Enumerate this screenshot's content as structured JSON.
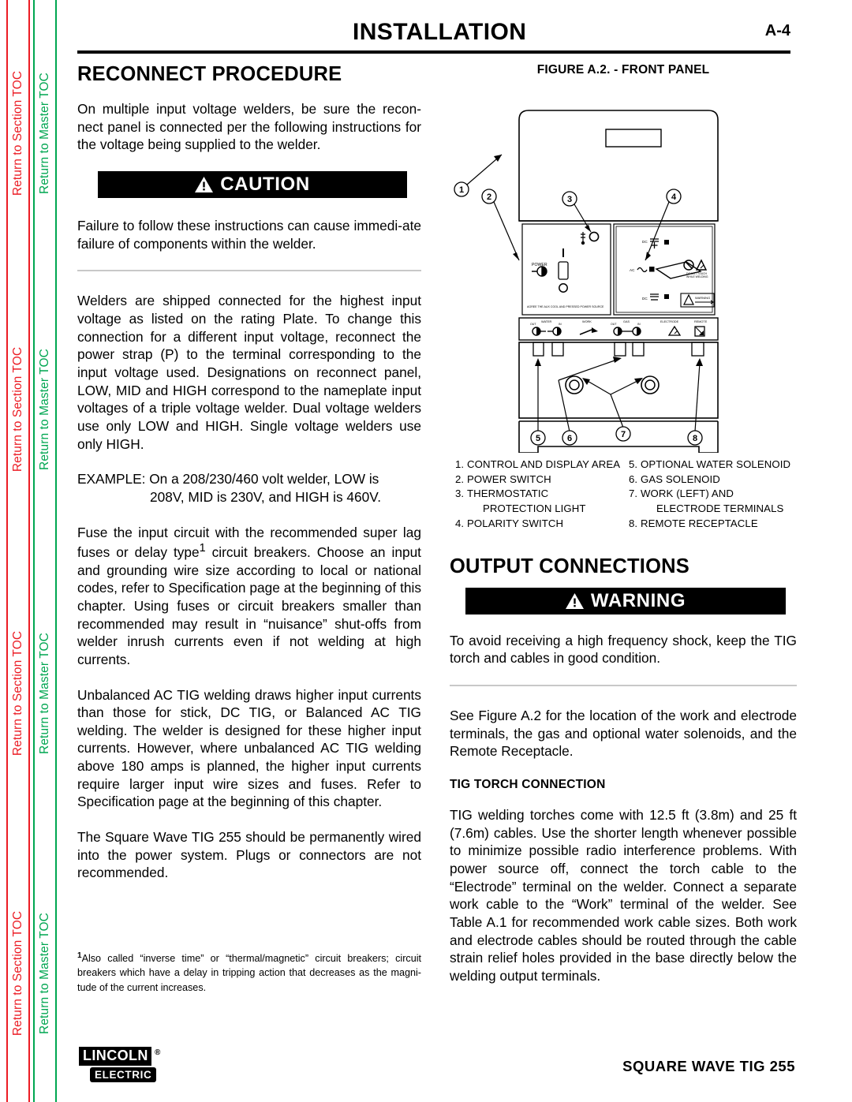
{
  "sidebar": {
    "section_toc_label": "Return to Section TOC",
    "master_toc_label": "Return to Master TOC",
    "section_color": "#ec1c24",
    "master_color": "#00a651",
    "repeat_count": 4
  },
  "header": {
    "title": "INSTALLATION",
    "page_number": "A-4"
  },
  "left_column": {
    "section_title": "RECONNECT PROCEDURE",
    "intro_paragraph": "On multiple input voltage welders, be sure the recon-nect panel is connected per the following instructions for the voltage being supplied to the welder.",
    "caution_banner": "CAUTION",
    "caution_text": "Failure to follow these instructions can cause immedi-ate failure of components within the welder.",
    "paragraph_2": "Welders are shipped connected for the highest input voltage as listed on the rating Plate. To change this connection for a different input voltage, reconnect the power strap (P) to the terminal corresponding to the input voltage used. Designations on reconnect panel, LOW, MID and HIGH correspond to the nameplate input voltages of a triple voltage welder. Dual voltage welders use only LOW and HIGH. Single voltage welders use only HIGH.",
    "example_label": "EXAMPLE: On a 208/230/460 volt welder, LOW is",
    "example_cont": "208V, MID is 230V, and HIGH is 460V.",
    "paragraph_3_a": "Fuse the input circuit with the recommended super lag fuses or delay type",
    "paragraph_3_sup": "1",
    "paragraph_3_b": " circuit breakers. Choose an input and grounding wire size according to local or national codes, refer to Specification page at the beginning of this chapter. Using fuses or circuit breakers smaller than recommended may result in “nuisance” shut-offs from welder inrush currents even if not welding at high currents.",
    "paragraph_4": "Unbalanced AC TIG welding draws higher input currents than those for stick, DC TIG, or Balanced AC TIG welding. The welder is designed for these higher input currents. However, where unbalanced AC TIG welding above 180 amps is planned, the higher input currents require larger input wire sizes and fuses. Refer to Specification page at the beginning of this chapter.",
    "paragraph_5": "The Square Wave TIG 255 should be permanently wired into the power system. Plugs or connectors are not recommended.",
    "footnote_marker": "1",
    "footnote_text": "Also called “inverse time” or “thermal/magnetic” circuit breakers; circuit breakers which have a delay in tripping action that decreases as the magni-tude of the current increases."
  },
  "figure": {
    "caption": "FIGURE A.2. - FRONT PANEL",
    "callouts": [
      "1",
      "2",
      "3",
      "4",
      "5",
      "6",
      "7",
      "8"
    ],
    "panel_labels": {
      "power": "POWER",
      "power_note": "AGREE THE  AUX COOL AND  PRESSED POWER SOURCE",
      "dc_plus": "DC",
      "ac": "AC",
      "dc_minus": "DC",
      "do_not_touch": "DO NOT TOUCH WHILE WELDING",
      "warning_small": "WARNING"
    },
    "terminal_labels": {
      "water": "WATER",
      "water_out": "OUT",
      "water_in": "IN",
      "work": "WORK",
      "gas": "GAS",
      "gas_out": "OUT",
      "gas_in": "IN",
      "electrode": "ELECTRODE",
      "remote": "REMOTE"
    },
    "legend_left": [
      {
        "num": "1.",
        "text": "CONTROL AND DISPLAY AREA"
      },
      {
        "num": "2.",
        "text": "POWER SWITCH"
      },
      {
        "num": "3.",
        "text": "THERMOSTATIC",
        "cont": "PROTECTION LIGHT"
      },
      {
        "num": "4.",
        "text": "POLARITY SWITCH"
      }
    ],
    "legend_right": [
      {
        "num": "5.",
        "text": "OPTIONAL WATER SOLENOID"
      },
      {
        "num": "6.",
        "text": "GAS SOLENOID"
      },
      {
        "num": "7.",
        "text": "WORK (LEFT) AND",
        "cont": "ELECTRODE  TERMINALS"
      },
      {
        "num": "8.",
        "text": "REMOTE RECEPTACLE"
      }
    ]
  },
  "right_column": {
    "section_title": "OUTPUT CONNECTIONS",
    "warning_banner": "WARNING",
    "warning_text": "To avoid receiving a high frequency shock, keep the TIG torch and cables in good condition.",
    "paragraph_1": "See Figure A.2 for the location of the work and electrode terminals, the gas and optional water solenoids, and the Remote Receptacle.",
    "sub_title": "TIG TORCH CONNECTION",
    "paragraph_2": "TIG welding torches come with 12.5 ft (3.8m) and 25 ft (7.6m) cables. Use the shorter length whenever possible to minimize possible radio interference problems. With power source off, connect the torch cable to the “Electrode” terminal on the welder. Connect a separate work cable to the “Work” terminal of the welder. See Table A.1 for recommended work cable sizes. Both work and electrode cables should be routed through the cable strain relief holes provided in the base directly below the welding output terminals."
  },
  "footer": {
    "logo_top": "LINCOLN",
    "logo_reg": "®",
    "logo_bottom": "ELECTRIC",
    "model": "SQUARE WAVE TIG 255"
  }
}
